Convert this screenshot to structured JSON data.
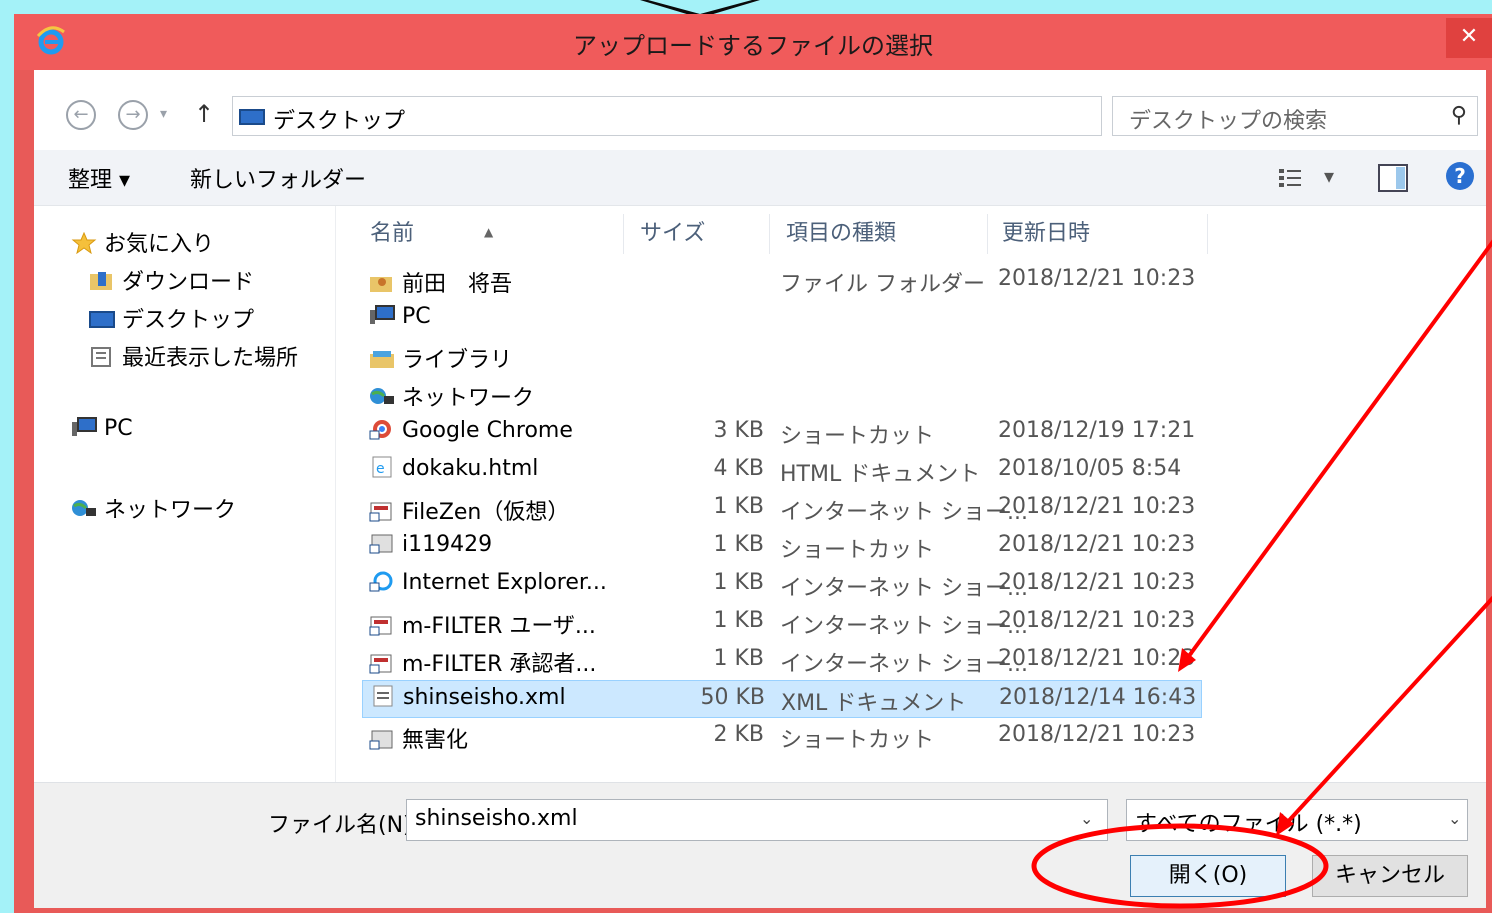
{
  "window": {
    "title": "アップロードするファイルの選択",
    "close_glyph": "✕"
  },
  "address": {
    "back_glyph": "←",
    "forward_glyph": "→",
    "dropdown_glyph": "▾",
    "up_glyph": "↑",
    "path": "デスクトップ",
    "refresh_glyph": "↻",
    "search_placeholder": "デスクトップの検索",
    "search_glyph": "⚲"
  },
  "toolbar": {
    "organize": "整理 ▾",
    "new_folder": "新しいフォルダー",
    "view_dd": "▾",
    "help_glyph": "?"
  },
  "nav": {
    "favorites": "お気に入り",
    "downloads": "ダウンロード",
    "desktop": "デスクトップ",
    "recent": "最近表示した場所",
    "pc": "PC",
    "network": "ネットワーク"
  },
  "columns": {
    "name": "名前",
    "size": "サイズ",
    "type": "項目の種類",
    "date": "更新日時",
    "sort_glyph": "▲"
  },
  "files": [
    {
      "name": "前田　将吾",
      "size": "",
      "type": "ファイル フォルダー",
      "date": "2018/12/21 10:23",
      "icon": "user-folder-icon"
    },
    {
      "name": "PC",
      "size": "",
      "type": "",
      "date": "",
      "icon": "pc-icon"
    },
    {
      "name": "ライブラリ",
      "size": "",
      "type": "",
      "date": "",
      "icon": "library-icon"
    },
    {
      "name": "ネットワーク",
      "size": "",
      "type": "",
      "date": "",
      "icon": "network-icon"
    },
    {
      "name": "Google Chrome",
      "size": "3 KB",
      "type": "ショートカット",
      "date": "2018/12/19 17:21",
      "icon": "chrome-shortcut-icon"
    },
    {
      "name": "dokaku.html",
      "size": "4 KB",
      "type": "HTML ドキュメント",
      "date": "2018/10/05 8:54",
      "icon": "html-file-icon"
    },
    {
      "name": "FileZen（仮想）",
      "size": "1 KB",
      "type": "インターネット ショー...",
      "date": "2018/12/21 10:23",
      "icon": "internet-shortcut-icon"
    },
    {
      "name": "i119429",
      "size": "1 KB",
      "type": "ショートカット",
      "date": "2018/12/21 10:23",
      "icon": "shortcut-icon"
    },
    {
      "name": "Internet Explorer...",
      "size": "1 KB",
      "type": "インターネット ショー...",
      "date": "2018/12/21 10:23",
      "icon": "ie-shortcut-icon"
    },
    {
      "name": "m-FILTER ユーザ...",
      "size": "1 KB",
      "type": "インターネット ショー...",
      "date": "2018/12/21 10:23",
      "icon": "internet-shortcut-icon"
    },
    {
      "name": "m-FILTER 承認者...",
      "size": "1 KB",
      "type": "インターネット ショー...",
      "date": "2018/12/21 10:23",
      "icon": "internet-shortcut-icon"
    },
    {
      "name": "shinseisho.xml",
      "size": "50 KB",
      "type": "XML ドキュメント",
      "date": "2018/12/14 16:43",
      "icon": "xml-file-icon"
    },
    {
      "name": "無害化",
      "size": "2 KB",
      "type": "ショートカット",
      "date": "2018/12/21 10:23",
      "icon": "shortcut-icon"
    }
  ],
  "bottom": {
    "filename_label": "ファイル名(N):",
    "filename_value": "shinseisho.xml",
    "filetype_value": "すべてのファイル (*.*)",
    "dd_glyph": "⌄",
    "open_label": "開く(O)",
    "cancel_label": "キャンセル"
  },
  "colors": {
    "background": "#a4f2f8",
    "titlebar": "#f05b5b",
    "selected_row": "#cce8ff",
    "annotation": "#ff0000"
  }
}
